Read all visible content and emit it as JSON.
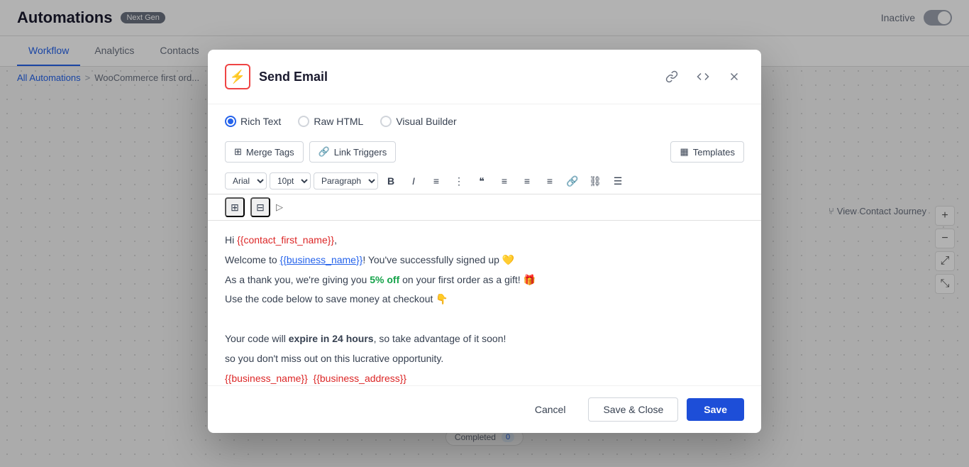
{
  "app": {
    "title": "Automations",
    "badge": "Next Gen",
    "status": "Inactive"
  },
  "breadcrumb": {
    "home": "All Automations",
    "separator": ">",
    "current": "WooCommerce first ord..."
  },
  "nav": {
    "tabs": [
      {
        "label": "Workflow",
        "active": true
      },
      {
        "label": "Analytics",
        "active": false
      },
      {
        "label": "Contacts",
        "active": false
      }
    ]
  },
  "modal": {
    "title": "Send Email",
    "icon": "⚡",
    "radio_tabs": [
      {
        "label": "Rich Text",
        "active": true
      },
      {
        "label": "Raw HTML",
        "active": false
      },
      {
        "label": "Visual Builder",
        "active": false
      }
    ],
    "toolbar": {
      "merge_tags_label": "Merge Tags",
      "link_triggers_label": "Link Triggers",
      "templates_label": "Templates"
    },
    "editor": {
      "font": "Arial",
      "font_size": "10pt",
      "paragraph": "Paragraph"
    },
    "content": {
      "line1": "Hi {{contact_first_name}},",
      "line2_pre": "Welcome to ",
      "line2_tag": "{{business_name}}",
      "line2_post": "! You've successfully signed up 💛",
      "line3_pre": "As a thank you, we're giving you ",
      "line3_bold": "5% off",
      "line3_post": " on your first order as a gift! 🎁",
      "line4_pre": "Use the code below to save money at checkout 👇",
      "line5": "",
      "line6_pre": "Your code will ",
      "line6_bold": "expire in 24 hours",
      "line6_post": ", so take advantage of it soon!",
      "line7": "so you don't miss out on this lucrative opportunity.",
      "line8": "{{business_name}}  {{business_address}}"
    },
    "footer": {
      "cancel": "Cancel",
      "save_close": "Save & Close",
      "save": "Save"
    }
  },
  "side_controls": {
    "add": "+",
    "minus": "−",
    "expand1": "⤢",
    "expand2": "⤡"
  },
  "view_contact_journey": "View Contact Journey",
  "canvas": {
    "completed_label": "Completed",
    "completed_count": "0"
  }
}
